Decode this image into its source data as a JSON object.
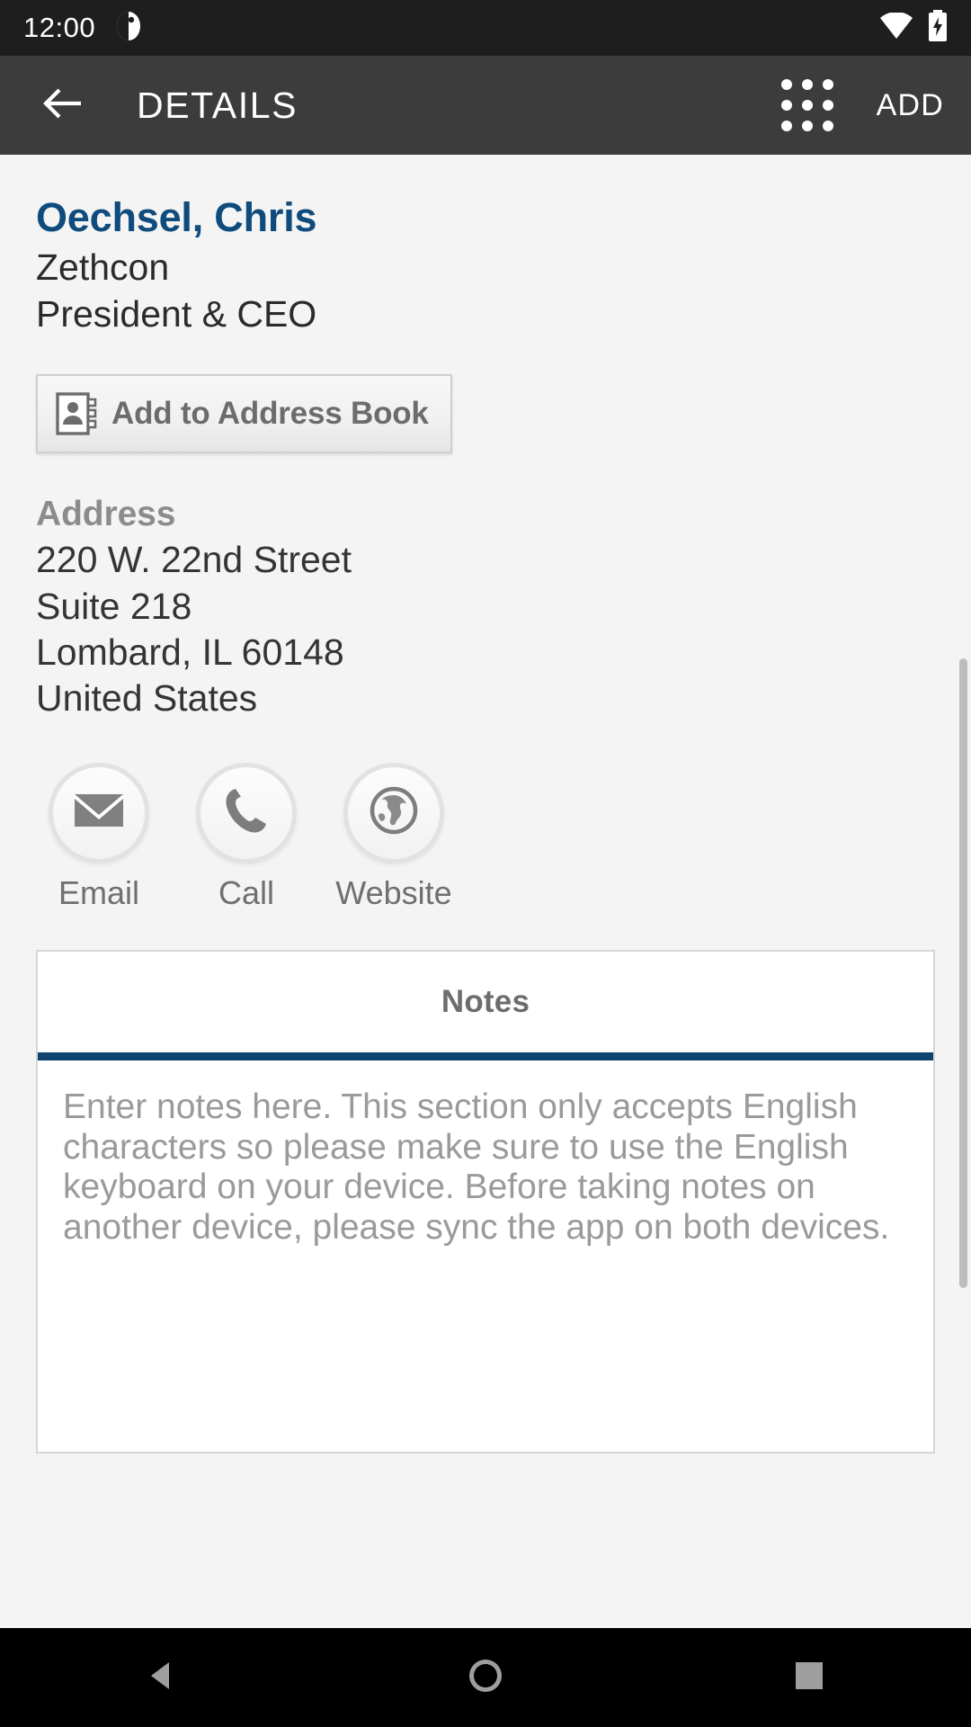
{
  "status_bar": {
    "clock": "12:00",
    "icons": {
      "notification": "notification-dot-icon",
      "wifi": "wifi-icon",
      "battery": "battery-charging-icon"
    }
  },
  "app_bar": {
    "back_icon": "arrow-back-icon",
    "title": "DETAILS",
    "grid_icon": "apps-grid-icon",
    "add_label": "ADD"
  },
  "contact": {
    "name": "Oechsel, Chris",
    "company": "Zethcon",
    "job_title": "President & CEO"
  },
  "address_book_button": {
    "label": "Add to Address Book",
    "icon": "contact-card-icon"
  },
  "address": {
    "section_label": "Address",
    "lines": [
      "220 W. 22nd Street",
      "Suite 218",
      "Lombard, IL 60148",
      "United States"
    ]
  },
  "actions": [
    {
      "label": "Email",
      "icon": "envelope-icon"
    },
    {
      "label": "Call",
      "icon": "phone-icon"
    },
    {
      "label": "Website",
      "icon": "globe-icon"
    }
  ],
  "notes": {
    "tab_label": "Notes",
    "placeholder": "Enter notes here. This section only accepts English characters so please make sure to use the English keyboard on your device. Before taking notes on another device, please sync the app on both devices.",
    "value": ""
  },
  "nav_bar": {
    "back": "nav-back-triangle-icon",
    "home": "nav-home-circle-icon",
    "recents": "nav-recents-square-icon"
  },
  "colors": {
    "accent_blue": "#0f4c7d",
    "tab_underline": "#0f4370",
    "app_bar": "#3c3c3c",
    "status_bar": "#1e1e1e",
    "page_bg": "#f4f4f4"
  }
}
